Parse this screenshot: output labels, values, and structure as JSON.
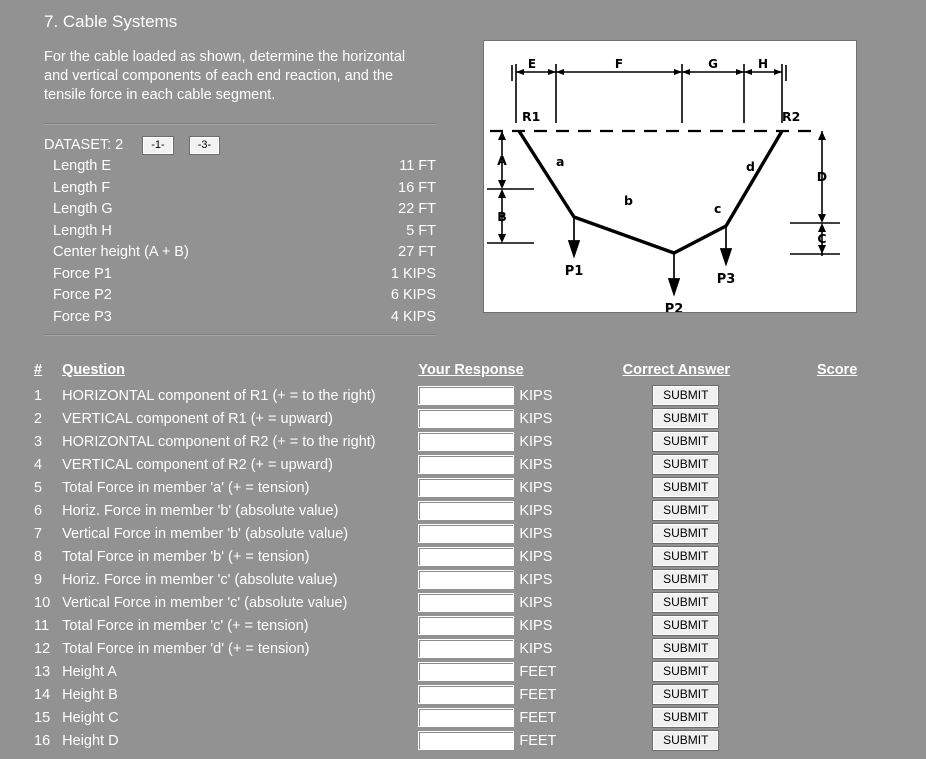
{
  "page": {
    "title": "7. Cable Systems",
    "prompt": "For the cable loaded as shown, determine the horizontal and vertical components of each end reaction, and the tensile force in each cable segment."
  },
  "dataset": {
    "label": "DATASET: 2",
    "buttons": [
      {
        "name": "dataset-prev-button",
        "label": "-1-"
      },
      {
        "name": "dataset-next-button",
        "label": "-3-"
      }
    ],
    "rows": [
      {
        "label": "Length E",
        "value": "11 FT"
      },
      {
        "label": "Length F",
        "value": "16 FT"
      },
      {
        "label": "Length G",
        "value": "22 FT"
      },
      {
        "label": "Length H",
        "value": "5 FT"
      },
      {
        "label": "Center height (A + B)",
        "value": "27 FT"
      },
      {
        "label": "Force P1",
        "value": "1 KIPS"
      },
      {
        "label": "Force P2",
        "value": "6 KIPS"
      },
      {
        "label": "Force P3",
        "value": "4 KIPS"
      }
    ]
  },
  "diagram": {
    "labels": {
      "span_e": "E",
      "span_f": "F",
      "span_g": "G",
      "span_h": "H",
      "reaction_left": "R1",
      "reaction_right": "R2",
      "height_a": "A",
      "height_b": "B",
      "height_c": "C",
      "height_d": "D",
      "member_a": "a",
      "member_b": "b",
      "member_c": "c",
      "member_d": "d",
      "load_p1": "P1",
      "load_p2": "P2",
      "load_p3": "P3"
    }
  },
  "table": {
    "headers": {
      "num": "#",
      "question": "Question",
      "response": "Your Response",
      "answer": "Correct Answer",
      "score": "Score"
    },
    "submit_label": "SUBMIT",
    "input_value": "",
    "rows": [
      {
        "num": "1",
        "question": "HORIZONTAL component of R1 (+ = to the right)",
        "unit": "KIPS",
        "score": ""
      },
      {
        "num": "2",
        "question": "VERTICAL component of R1 (+ = upward)",
        "unit": "KIPS",
        "score": ""
      },
      {
        "num": "3",
        "question": "HORIZONTAL component of R2 (+ = to the right)",
        "unit": "KIPS",
        "score": ""
      },
      {
        "num": "4",
        "question": "VERTICAL component of R2 (+ = upward)",
        "unit": "KIPS",
        "score": ""
      },
      {
        "num": "5",
        "question": "Total Force in member 'a' (+ = tension)",
        "unit": "KIPS",
        "score": ""
      },
      {
        "num": "6",
        "question": "Horiz. Force in member 'b' (absolute value)",
        "unit": "KIPS",
        "score": ""
      },
      {
        "num": "7",
        "question": "Vertical Force in member 'b' (absolute value)",
        "unit": "KIPS",
        "score": ""
      },
      {
        "num": "8",
        "question": "Total Force in member 'b' (+ = tension)",
        "unit": "KIPS",
        "score": ""
      },
      {
        "num": "9",
        "question": "Horiz. Force in member 'c' (absolute value)",
        "unit": "KIPS",
        "score": ""
      },
      {
        "num": "10",
        "question": "Vertical Force in member 'c' (absolute value)",
        "unit": "KIPS",
        "score": ""
      },
      {
        "num": "11",
        "question": "Total Force in member 'c' (+ = tension)",
        "unit": "KIPS",
        "score": ""
      },
      {
        "num": "12",
        "question": "Total Force in member 'd' (+ = tension)",
        "unit": "KIPS",
        "score": ""
      },
      {
        "num": "13",
        "question": "Height A",
        "unit": "FEET",
        "score": ""
      },
      {
        "num": "14",
        "question": "Height B",
        "unit": "FEET",
        "score": ""
      },
      {
        "num": "15",
        "question": "Height C",
        "unit": "FEET",
        "score": ""
      },
      {
        "num": "16",
        "question": "Height D",
        "unit": "FEET",
        "score": ""
      }
    ]
  },
  "colors": {
    "background": "#929292",
    "text": "#ffffff",
    "panel": "#ffffff",
    "button_face": "#f0f0f0"
  }
}
